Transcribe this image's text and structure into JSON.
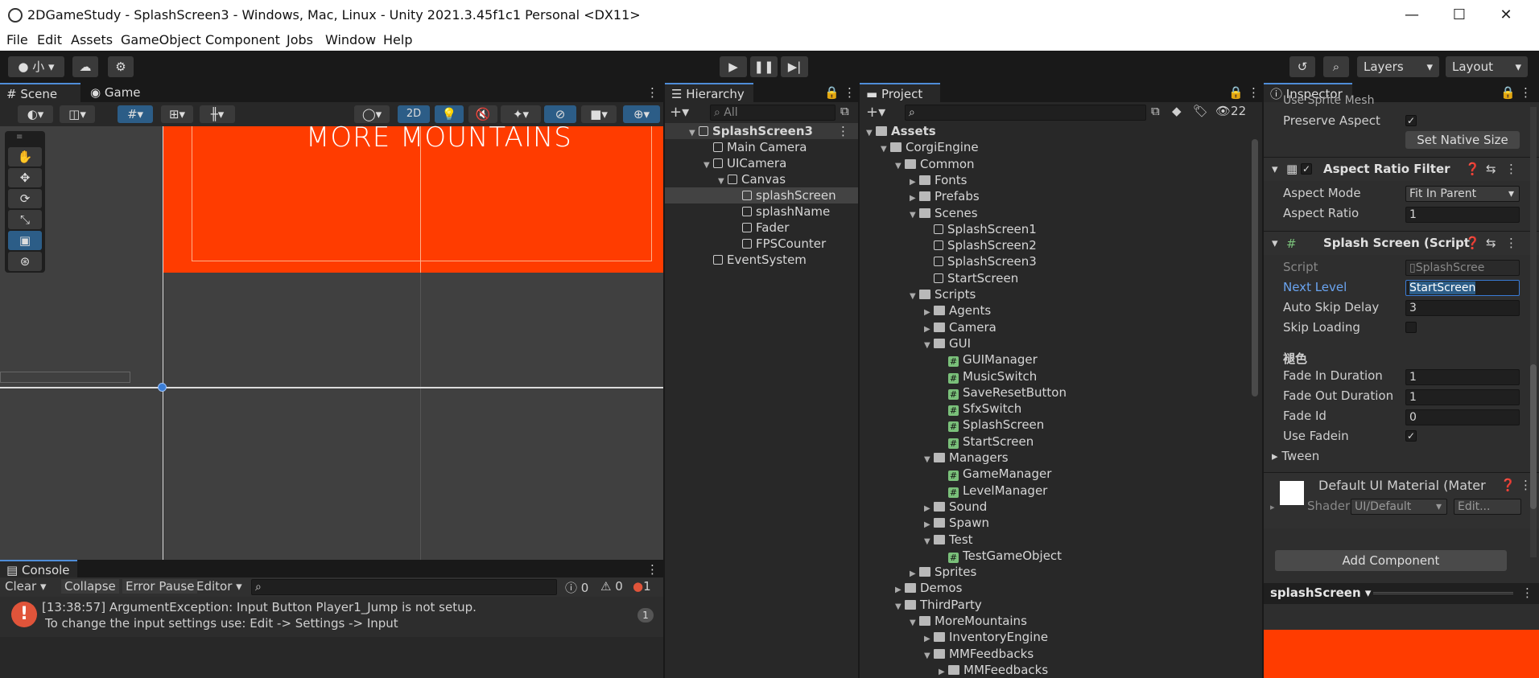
{
  "window": {
    "title": "2DGameStudy - SplashScreen3 - Windows, Mac, Linux - Unity 2021.3.45f1c1 Personal <DX11>"
  },
  "menu": [
    "File",
    "Edit",
    "Assets",
    "GameObject",
    "Component",
    "Jobs",
    "Window",
    "Help"
  ],
  "toolbar": {
    "account": "小",
    "layers": "Layers",
    "layout": "Layout"
  },
  "scene": {
    "tab_scene": "Scene",
    "tab_game": "Game",
    "mode_2d": "2D",
    "logo_text": "MORE MOUNTAINS"
  },
  "console": {
    "tab": "Console",
    "clear": "Clear",
    "collapse": "Collapse",
    "error_pause": "Error Pause",
    "editor": "Editor",
    "count_log": "0",
    "count_warn": "0",
    "count_err": "1",
    "message_line1": "[13:38:57] ArgumentException: Input Button Player1_Jump is not setup.",
    "message_line2": "To change the input settings use: Edit -> Settings -> Input",
    "message_count": "1"
  },
  "hierarchy": {
    "tab": "Hierarchy",
    "search_placeholder": "All",
    "items": [
      {
        "label": "SplashScreen3",
        "depth": 0,
        "icon": "unity-scene-icon"
      },
      {
        "label": "Main Camera",
        "depth": 1,
        "icon": "cube-icon"
      },
      {
        "label": "UICamera",
        "depth": 1,
        "icon": "cube-icon"
      },
      {
        "label": "Canvas",
        "depth": 2,
        "icon": "cube-icon"
      },
      {
        "label": "splashScreen",
        "depth": 3,
        "icon": "cube-icon"
      },
      {
        "label": "splashName",
        "depth": 3,
        "icon": "cube-icon"
      },
      {
        "label": "Fader",
        "depth": 3,
        "icon": "cube-icon"
      },
      {
        "label": "FPSCounter",
        "depth": 3,
        "icon": "cube-icon"
      },
      {
        "label": "EventSystem",
        "depth": 1,
        "icon": "cube-icon"
      }
    ]
  },
  "project": {
    "tab": "Project",
    "hidden_count": "22",
    "items": [
      {
        "label": "Assets",
        "depth": 0,
        "type": "folder"
      },
      {
        "label": "CorgiEngine",
        "depth": 1,
        "type": "folder"
      },
      {
        "label": "Common",
        "depth": 2,
        "type": "folder"
      },
      {
        "label": "Fonts",
        "depth": 3,
        "type": "folder"
      },
      {
        "label": "Prefabs",
        "depth": 3,
        "type": "folder"
      },
      {
        "label": "Scenes",
        "depth": 3,
        "type": "folder"
      },
      {
        "label": "SplashScreen1",
        "depth": 4,
        "type": "scene"
      },
      {
        "label": "SplashScreen2",
        "depth": 4,
        "type": "scene"
      },
      {
        "label": "SplashScreen3",
        "depth": 4,
        "type": "scene"
      },
      {
        "label": "StartScreen",
        "depth": 4,
        "type": "scene"
      },
      {
        "label": "Scripts",
        "depth": 3,
        "type": "folder"
      },
      {
        "label": "Agents",
        "depth": 4,
        "type": "folder"
      },
      {
        "label": "Camera",
        "depth": 4,
        "type": "folder"
      },
      {
        "label": "GUI",
        "depth": 4,
        "type": "folder"
      },
      {
        "label": "GUIManager",
        "depth": 5,
        "type": "script"
      },
      {
        "label": "MusicSwitch",
        "depth": 5,
        "type": "script"
      },
      {
        "label": "SaveResetButton",
        "depth": 5,
        "type": "script"
      },
      {
        "label": "SfxSwitch",
        "depth": 5,
        "type": "script"
      },
      {
        "label": "SplashScreen",
        "depth": 5,
        "type": "script"
      },
      {
        "label": "StartScreen",
        "depth": 5,
        "type": "script"
      },
      {
        "label": "Managers",
        "depth": 4,
        "type": "folder"
      },
      {
        "label": "GameManager",
        "depth": 5,
        "type": "script"
      },
      {
        "label": "LevelManager",
        "depth": 5,
        "type": "script"
      },
      {
        "label": "Sound",
        "depth": 4,
        "type": "folder"
      },
      {
        "label": "Spawn",
        "depth": 4,
        "type": "folder"
      },
      {
        "label": "Test",
        "depth": 4,
        "type": "folder"
      },
      {
        "label": "TestGameObject",
        "depth": 5,
        "type": "script"
      },
      {
        "label": "Sprites",
        "depth": 3,
        "type": "folder"
      },
      {
        "label": "Demos",
        "depth": 2,
        "type": "folder"
      },
      {
        "label": "ThirdParty",
        "depth": 2,
        "type": "folder"
      },
      {
        "label": "MoreMountains",
        "depth": 3,
        "type": "folder"
      },
      {
        "label": "InventoryEngine",
        "depth": 4,
        "type": "folder"
      },
      {
        "label": "MMFeedbacks",
        "depth": 4,
        "type": "folder"
      },
      {
        "label": "MMFeedbacks",
        "depth": 5,
        "type": "folder"
      }
    ]
  },
  "inspector": {
    "tab": "Inspector",
    "use_sprite_mesh": "Use Sprite Mesh",
    "preserve_aspect": "Preserve Aspect",
    "set_native_size": "Set Native Size",
    "aspect_header": "Aspect Ratio Filter",
    "aspect_mode_label": "Aspect Mode",
    "aspect_mode_value": "Fit In Parent",
    "aspect_ratio_label": "Aspect Ratio",
    "aspect_ratio_value": "1",
    "splash_header": "Splash Screen (Script",
    "script_label": "Script",
    "script_value": "SplashScree",
    "next_level_label": "Next Level",
    "next_level_value": "StartScreen",
    "auto_skip_label": "Auto Skip Delay",
    "auto_skip_value": "3",
    "skip_loading_label": "Skip Loading",
    "section_label": "褪色",
    "fade_in_label": "Fade In Duration",
    "fade_in_value": "1",
    "fade_out_label": "Fade Out Duration",
    "fade_out_value": "1",
    "fade_id_label": "Fade Id",
    "fade_id_value": "0",
    "use_fadein_label": "Use Fadein",
    "tween_label": "Tween",
    "material_title": "Default UI Material (Mater",
    "shader_label": "Shader",
    "shader_value": "UI/Default",
    "edit_button": "Edit...",
    "add_component": "Add Component",
    "preview_title": "splashScreen"
  },
  "colors": {
    "accent": "#4f8dd8",
    "splash_orange": "#ff3c00",
    "error_red": "#e0543a",
    "selected": "#2c5d87"
  }
}
